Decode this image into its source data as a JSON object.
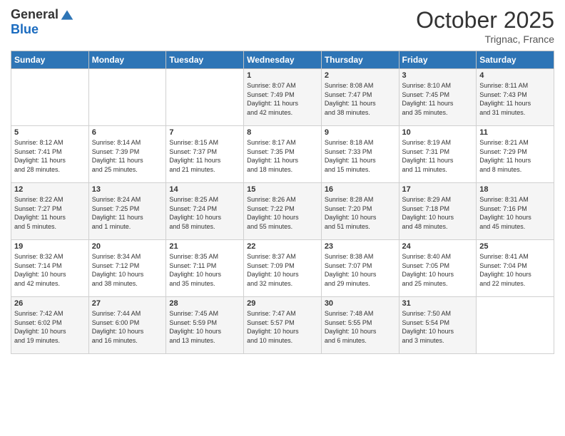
{
  "header": {
    "logo_general": "General",
    "logo_blue": "Blue",
    "month_title": "October 2025",
    "subtitle": "Trignac, France"
  },
  "weekdays": [
    "Sunday",
    "Monday",
    "Tuesday",
    "Wednesday",
    "Thursday",
    "Friday",
    "Saturday"
  ],
  "weeks": [
    [
      {
        "day": "",
        "info": ""
      },
      {
        "day": "",
        "info": ""
      },
      {
        "day": "",
        "info": ""
      },
      {
        "day": "1",
        "info": "Sunrise: 8:07 AM\nSunset: 7:49 PM\nDaylight: 11 hours\nand 42 minutes."
      },
      {
        "day": "2",
        "info": "Sunrise: 8:08 AM\nSunset: 7:47 PM\nDaylight: 11 hours\nand 38 minutes."
      },
      {
        "day": "3",
        "info": "Sunrise: 8:10 AM\nSunset: 7:45 PM\nDaylight: 11 hours\nand 35 minutes."
      },
      {
        "day": "4",
        "info": "Sunrise: 8:11 AM\nSunset: 7:43 PM\nDaylight: 11 hours\nand 31 minutes."
      }
    ],
    [
      {
        "day": "5",
        "info": "Sunrise: 8:12 AM\nSunset: 7:41 PM\nDaylight: 11 hours\nand 28 minutes."
      },
      {
        "day": "6",
        "info": "Sunrise: 8:14 AM\nSunset: 7:39 PM\nDaylight: 11 hours\nand 25 minutes."
      },
      {
        "day": "7",
        "info": "Sunrise: 8:15 AM\nSunset: 7:37 PM\nDaylight: 11 hours\nand 21 minutes."
      },
      {
        "day": "8",
        "info": "Sunrise: 8:17 AM\nSunset: 7:35 PM\nDaylight: 11 hours\nand 18 minutes."
      },
      {
        "day": "9",
        "info": "Sunrise: 8:18 AM\nSunset: 7:33 PM\nDaylight: 11 hours\nand 15 minutes."
      },
      {
        "day": "10",
        "info": "Sunrise: 8:19 AM\nSunset: 7:31 PM\nDaylight: 11 hours\nand 11 minutes."
      },
      {
        "day": "11",
        "info": "Sunrise: 8:21 AM\nSunset: 7:29 PM\nDaylight: 11 hours\nand 8 minutes."
      }
    ],
    [
      {
        "day": "12",
        "info": "Sunrise: 8:22 AM\nSunset: 7:27 PM\nDaylight: 11 hours\nand 5 minutes."
      },
      {
        "day": "13",
        "info": "Sunrise: 8:24 AM\nSunset: 7:25 PM\nDaylight: 11 hours\nand 1 minute."
      },
      {
        "day": "14",
        "info": "Sunrise: 8:25 AM\nSunset: 7:24 PM\nDaylight: 10 hours\nand 58 minutes."
      },
      {
        "day": "15",
        "info": "Sunrise: 8:26 AM\nSunset: 7:22 PM\nDaylight: 10 hours\nand 55 minutes."
      },
      {
        "day": "16",
        "info": "Sunrise: 8:28 AM\nSunset: 7:20 PM\nDaylight: 10 hours\nand 51 minutes."
      },
      {
        "day": "17",
        "info": "Sunrise: 8:29 AM\nSunset: 7:18 PM\nDaylight: 10 hours\nand 48 minutes."
      },
      {
        "day": "18",
        "info": "Sunrise: 8:31 AM\nSunset: 7:16 PM\nDaylight: 10 hours\nand 45 minutes."
      }
    ],
    [
      {
        "day": "19",
        "info": "Sunrise: 8:32 AM\nSunset: 7:14 PM\nDaylight: 10 hours\nand 42 minutes."
      },
      {
        "day": "20",
        "info": "Sunrise: 8:34 AM\nSunset: 7:12 PM\nDaylight: 10 hours\nand 38 minutes."
      },
      {
        "day": "21",
        "info": "Sunrise: 8:35 AM\nSunset: 7:11 PM\nDaylight: 10 hours\nand 35 minutes."
      },
      {
        "day": "22",
        "info": "Sunrise: 8:37 AM\nSunset: 7:09 PM\nDaylight: 10 hours\nand 32 minutes."
      },
      {
        "day": "23",
        "info": "Sunrise: 8:38 AM\nSunset: 7:07 PM\nDaylight: 10 hours\nand 29 minutes."
      },
      {
        "day": "24",
        "info": "Sunrise: 8:40 AM\nSunset: 7:05 PM\nDaylight: 10 hours\nand 25 minutes."
      },
      {
        "day": "25",
        "info": "Sunrise: 8:41 AM\nSunset: 7:04 PM\nDaylight: 10 hours\nand 22 minutes."
      }
    ],
    [
      {
        "day": "26",
        "info": "Sunrise: 7:42 AM\nSunset: 6:02 PM\nDaylight: 10 hours\nand 19 minutes."
      },
      {
        "day": "27",
        "info": "Sunrise: 7:44 AM\nSunset: 6:00 PM\nDaylight: 10 hours\nand 16 minutes."
      },
      {
        "day": "28",
        "info": "Sunrise: 7:45 AM\nSunset: 5:59 PM\nDaylight: 10 hours\nand 13 minutes."
      },
      {
        "day": "29",
        "info": "Sunrise: 7:47 AM\nSunset: 5:57 PM\nDaylight: 10 hours\nand 10 minutes."
      },
      {
        "day": "30",
        "info": "Sunrise: 7:48 AM\nSunset: 5:55 PM\nDaylight: 10 hours\nand 6 minutes."
      },
      {
        "day": "31",
        "info": "Sunrise: 7:50 AM\nSunset: 5:54 PM\nDaylight: 10 hours\nand 3 minutes."
      },
      {
        "day": "",
        "info": ""
      }
    ]
  ]
}
